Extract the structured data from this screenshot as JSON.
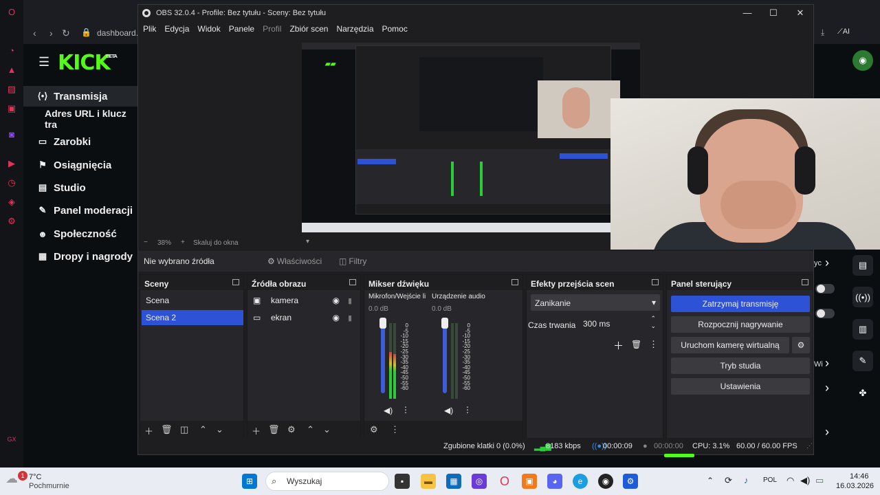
{
  "browser": {
    "url": "dashboard.",
    "kick_logo": "KICK",
    "kick_beta": "BETA",
    "nav": [
      {
        "label": "Transmisja",
        "icon": "broadcast-icon"
      },
      {
        "label": "Adres URL i klucz tra"
      },
      {
        "label": "Zarobki",
        "icon": "money-icon"
      },
      {
        "label": "Osiągnięcia",
        "icon": "trophy-icon"
      },
      {
        "label": "Studio",
        "icon": "studio-icon"
      },
      {
        "label": "Panel moderacji",
        "icon": "wrench-icon"
      },
      {
        "label": "Społeczność",
        "icon": "people-icon"
      },
      {
        "label": "Dropy i nagrody",
        "icon": "gift-icon"
      }
    ],
    "right_labels": {
      "a": "yc",
      "b": "Wi"
    }
  },
  "obs": {
    "title": "OBS 32.0.4 - Profile: Bez tytułu - Sceny: Bez tytułu",
    "menu": [
      "Plik",
      "Edycja",
      "Widok",
      "Panele",
      "Profil",
      "Zbiór scen",
      "Narzędzia",
      "Pomoc"
    ],
    "zoom": "38%",
    "zoom_minus": "−",
    "zoom_plus": "+",
    "scale_label": "Skaluj do okna",
    "no_source": "Nie wybrano źródła",
    "properties": "Właściwości",
    "filters": "Filtry",
    "scenes": {
      "title": "Sceny",
      "items": [
        "Scena",
        "Scena 2"
      ],
      "selected": 1
    },
    "sources": {
      "title": "Źródła obrazu",
      "items": [
        {
          "label": "kamera",
          "icon": "camera-icon"
        },
        {
          "label": "ekran",
          "icon": "monitor-icon"
        }
      ]
    },
    "mixer": {
      "title": "Mikser dźwięku",
      "channels": [
        {
          "name": "Mikrofon/Wejście li",
          "db": "0.0 dB",
          "level": 0.62
        },
        {
          "name": "Urządzenie audio",
          "db": "0.0 dB",
          "level": 0.0
        }
      ],
      "ticks": [
        "0",
        "-5",
        "-10",
        "-15",
        "-20",
        "-25",
        "-30",
        "-35",
        "-40",
        "-45",
        "-50",
        "-55",
        "-60"
      ]
    },
    "transitions": {
      "title": "Efekty przejścia scen",
      "selected": "Zanikanie",
      "duration_label": "Czas trwania",
      "duration": "300 ms"
    },
    "controls": {
      "title": "Panel sterujący",
      "stop_stream": "Zatrzymaj transmisję",
      "start_record": "Rozpocznij nagrywanie",
      "virtual_cam": "Uruchom kamerę wirtualną",
      "studio_mode": "Tryb studia",
      "settings": "Ustawienia"
    },
    "status": {
      "dropped": "Zgubione klatki 0 (0.0%)",
      "bitrate": "8183 kbps",
      "stream_time": "00:00:09",
      "rec_time": "00:00:00",
      "cpu": "CPU: 3.1%",
      "fps": "60.00 / 60.00 FPS"
    }
  },
  "taskbar": {
    "weather_temp": "7°C",
    "weather_desc": "Pochmurnie",
    "notif_count": "1",
    "search": "Wyszukaj",
    "lang": "POL",
    "time": "14:46",
    "date": "16.03.2026"
  },
  "colors": {
    "kick_green": "#53fc18",
    "obs_accent": "#2e52d6"
  }
}
